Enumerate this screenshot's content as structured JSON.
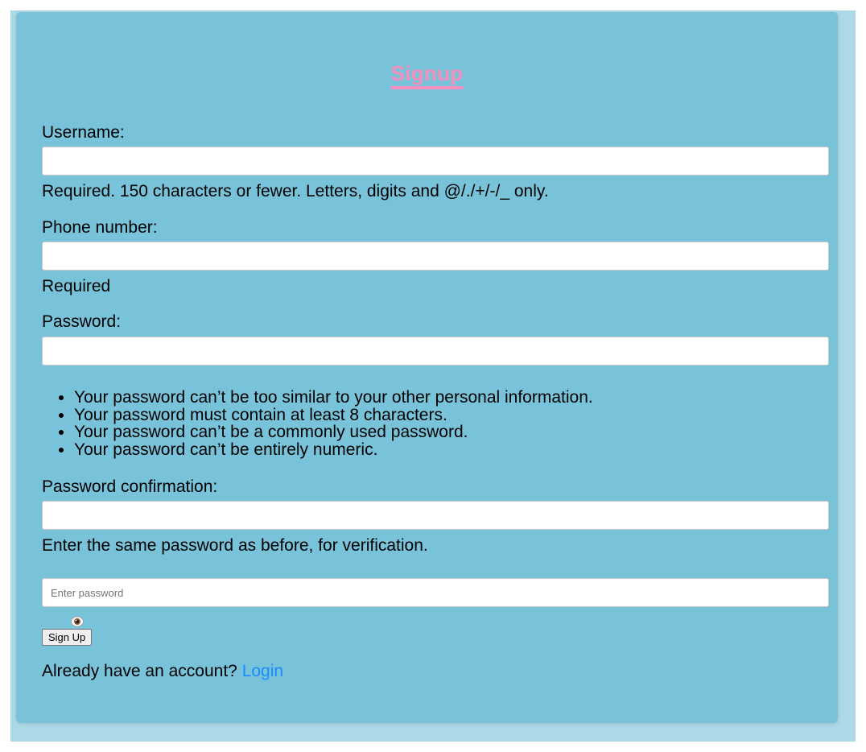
{
  "form": {
    "title": "Signup",
    "username": {
      "label": "Username:",
      "value": "",
      "help": "Required. 150 characters or fewer. Letters, digits and @/./+/-/_ only."
    },
    "phone": {
      "label": "Phone number:",
      "value": "",
      "help": "Required"
    },
    "password": {
      "label": "Password:",
      "value": "",
      "rules": [
        "Your password can’t be too similar to your other personal information.",
        "Your password must contain at least 8 characters.",
        "Your password can’t be a commonly used password.",
        "Your password can’t be entirely numeric."
      ]
    },
    "password_confirmation": {
      "label": "Password confirmation:",
      "value": "",
      "help": "Enter the same password as before, for verification."
    },
    "toggle_password": {
      "placeholder": "Enter password",
      "value": "",
      "icon": "eye-icon"
    },
    "submit_label": "Sign Up",
    "login_prompt": "Already have an account?",
    "login_link": "Login"
  },
  "colors": {
    "page_background": "#add8e6",
    "card_background": "#78c3da",
    "title": "#f58fbe",
    "link": "#1a8cff"
  }
}
